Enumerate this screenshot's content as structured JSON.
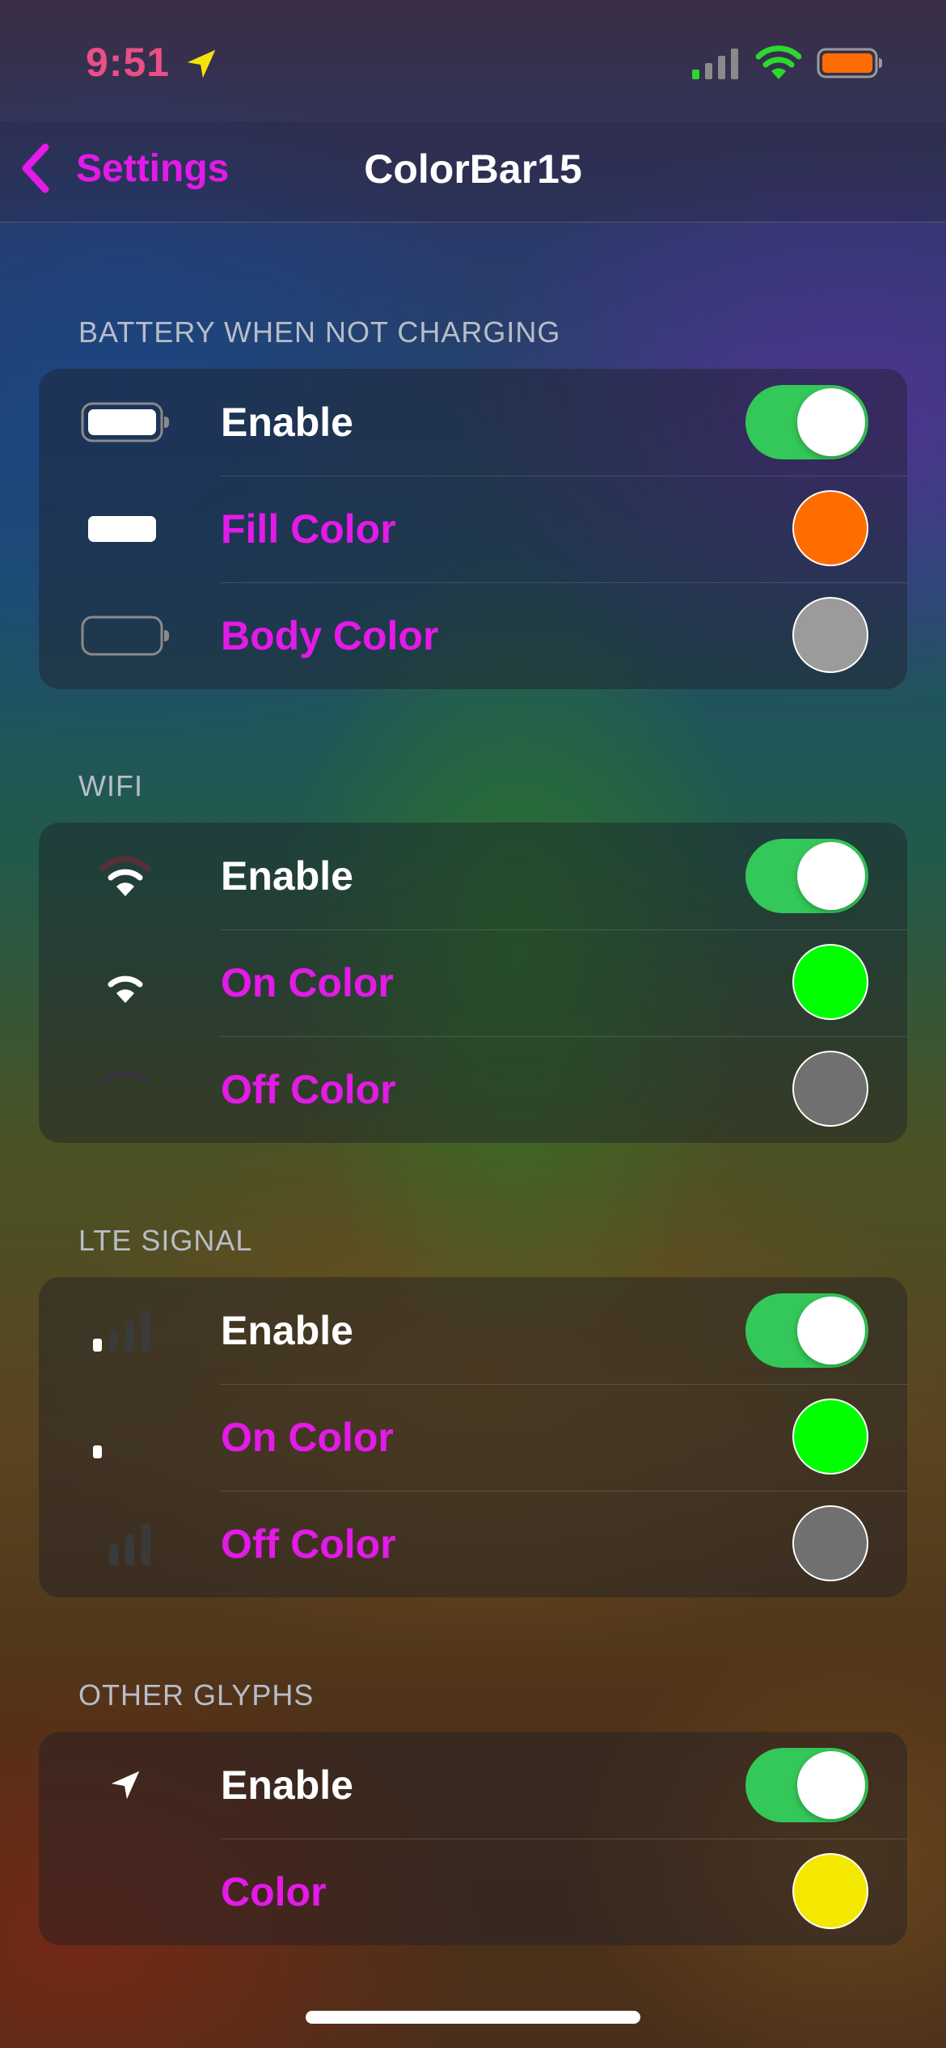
{
  "status_bar": {
    "time": "9:51",
    "time_color": "#ea4f86",
    "location_arrow_color": "#f5e30d",
    "signal_on_color": "#2cd92c",
    "wifi_color": "#2cd92c",
    "battery_fill_color": "#ff6d00",
    "icons": [
      "location-arrow-icon",
      "cellular-signal-icon",
      "wifi-icon",
      "battery-icon"
    ]
  },
  "nav": {
    "back_label": "Settings",
    "title": "ColorBar15",
    "accent_color": "#e31ae8"
  },
  "sections": [
    {
      "header": "BATTERY WHEN NOT CHARGING",
      "rows": [
        {
          "icon": "battery-full-icon",
          "label": "Enable",
          "control": "toggle",
          "on": true
        },
        {
          "icon": "battery-fill-icon",
          "label": "Fill Color",
          "control": "color",
          "color": "#ff6d00"
        },
        {
          "icon": "battery-body-icon",
          "label": "Body Color",
          "control": "color",
          "color": "#9b9b9b"
        }
      ]
    },
    {
      "header": "WIFI",
      "rows": [
        {
          "icon": "wifi-icon",
          "label": "Enable",
          "control": "toggle",
          "on": true
        },
        {
          "icon": "wifi-on-icon",
          "label": "On Color",
          "control": "color",
          "color": "#00ff00"
        },
        {
          "icon": "wifi-off-icon",
          "label": "Off Color",
          "control": "color",
          "color": "#707070"
        }
      ]
    },
    {
      "header": "LTE SIGNAL",
      "rows": [
        {
          "icon": "signal-bars-icon",
          "label": "Enable",
          "control": "toggle",
          "on": true
        },
        {
          "icon": "signal-on-icon",
          "label": "On Color",
          "control": "color",
          "color": "#00ff00"
        },
        {
          "icon": "signal-off-icon",
          "label": "Off Color",
          "control": "color",
          "color": "#707070"
        }
      ]
    },
    {
      "header": "OTHER GLYPHS",
      "rows": [
        {
          "icon": "location-arrow-icon",
          "label": "Enable",
          "control": "toggle",
          "on": true
        },
        {
          "icon": "",
          "label": "Color",
          "control": "color",
          "color": "#f5e800"
        }
      ]
    }
  ],
  "toggle_on_color": "#34c759"
}
